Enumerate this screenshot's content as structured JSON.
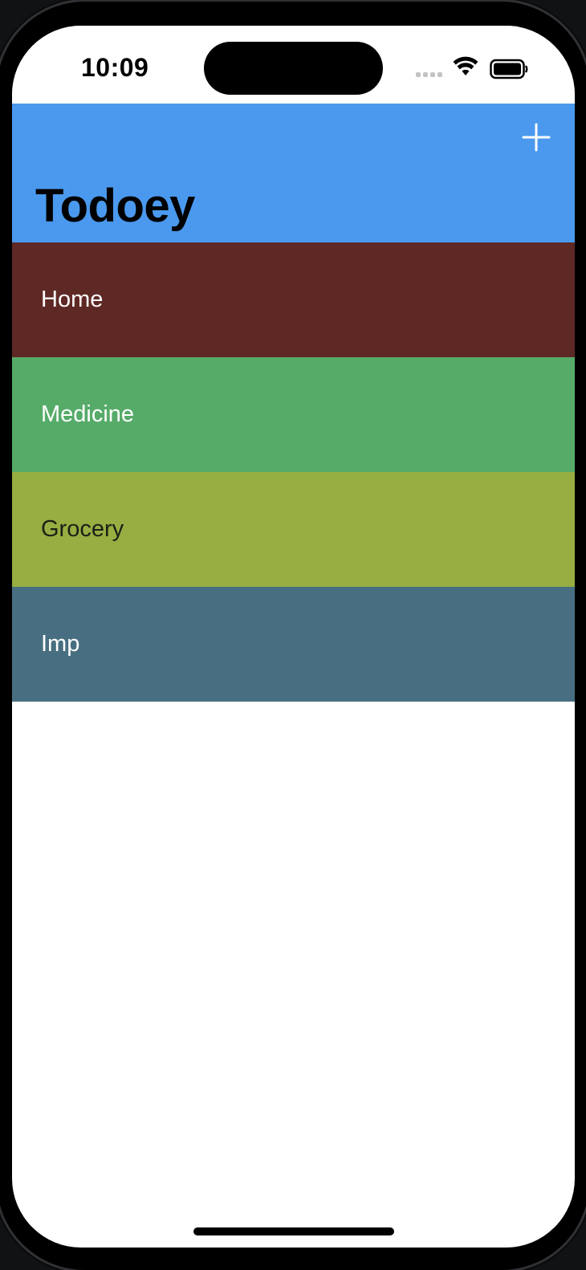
{
  "status_bar": {
    "time": "10:09"
  },
  "nav_bar": {
    "title": "Todoey",
    "background_color": "#4a99ee",
    "add_icon": "plus-icon"
  },
  "categories": [
    {
      "label": "Home",
      "background_color": "#5e2925",
      "text_color": "#ffffff"
    },
    {
      "label": "Medicine",
      "background_color": "#56ab69",
      "text_color": "#ffffff"
    },
    {
      "label": "Grocery",
      "background_color": "#96ae42",
      "text_color": "#1d1f17"
    },
    {
      "label": "Imp",
      "background_color": "#486f81",
      "text_color": "#ffffff"
    }
  ]
}
